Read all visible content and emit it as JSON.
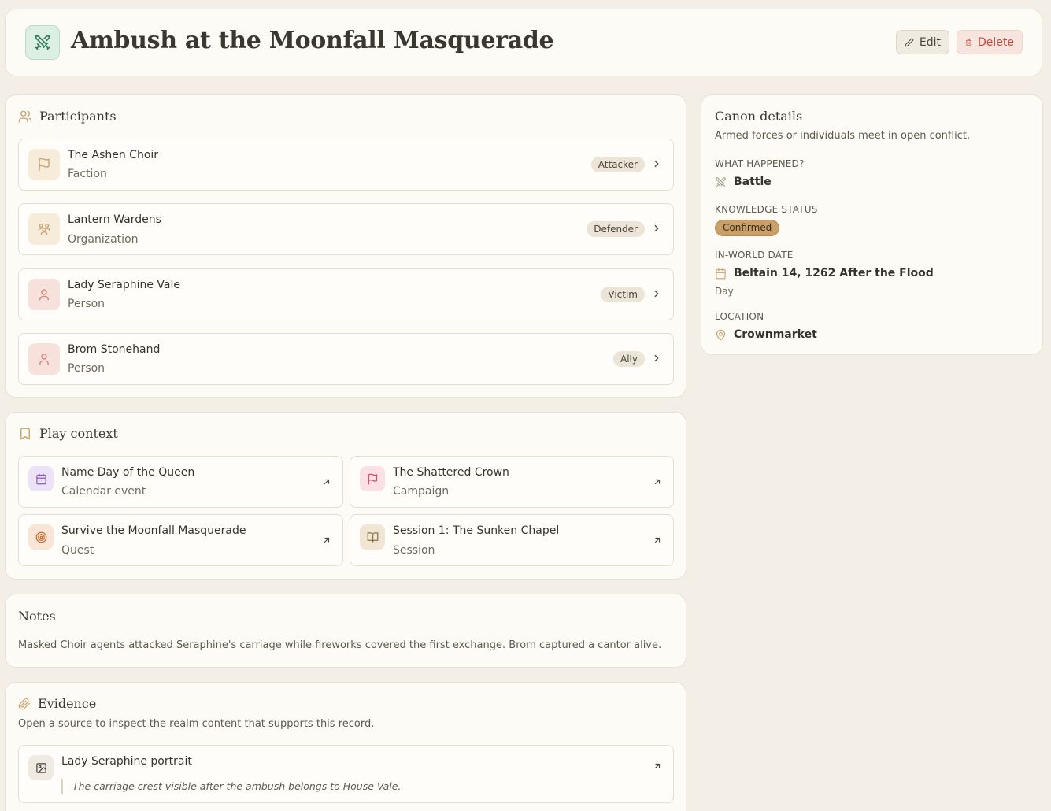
{
  "header": {
    "title": "Ambush at the Moonfall Masquerade",
    "edit_label": "Edit",
    "delete_label": "Delete",
    "icon": "swords-icon"
  },
  "participants": {
    "title": "Participants",
    "items": [
      {
        "name": "The Ashen Choir",
        "type": "Faction",
        "role": "Attacker",
        "icon": "flag-icon"
      },
      {
        "name": "Lantern Wardens",
        "type": "Organization",
        "role": "Defender",
        "icon": "group-icon"
      },
      {
        "name": "Lady Seraphine Vale",
        "type": "Person",
        "role": "Victim",
        "icon": "person-icon"
      },
      {
        "name": "Brom Stonehand",
        "type": "Person",
        "role": "Ally",
        "icon": "person-icon"
      }
    ]
  },
  "play_context": {
    "title": "Play context",
    "items": [
      {
        "name": "Name Day of the Queen",
        "type": "Calendar event",
        "icon": "calendar-icon"
      },
      {
        "name": "The Shattered Crown",
        "type": "Campaign",
        "icon": "flag-icon"
      },
      {
        "name": "Survive the Moonfall Masquerade",
        "type": "Quest",
        "icon": "target-icon"
      },
      {
        "name": "Session 1: The Sunken Chapel",
        "type": "Session",
        "icon": "book-icon"
      }
    ]
  },
  "notes": {
    "title": "Notes",
    "text": "Masked Choir agents attacked Seraphine's carriage while fireworks covered the first exchange. Brom captured a cantor alive."
  },
  "evidence": {
    "title": "Evidence",
    "subtitle": "Open a source to inspect the realm content that supports this record.",
    "items": [
      {
        "name": "Lady Seraphine portrait",
        "quote": "The carriage crest visible after the ambush belongs to House Vale."
      }
    ]
  },
  "canon": {
    "title": "Canon details",
    "description": "Armed forces or individuals meet in open conflict.",
    "what_label": "WHAT HAPPENED?",
    "what_value": "Battle",
    "status_label": "KNOWLEDGE STATUS",
    "status_value": "Confirmed",
    "date_label": "IN-WORLD DATE",
    "date_value": "Beltain 14, 1262 After the Flood",
    "date_precision": "Day",
    "location_label": "LOCATION",
    "location_value": "Crownmarket"
  },
  "colors": {
    "background": "#f3efe6",
    "card": "#fdfbf5",
    "delete": "#c0503c",
    "status_badge": "#c9a06a",
    "header_icon": "#2f7d5a"
  }
}
